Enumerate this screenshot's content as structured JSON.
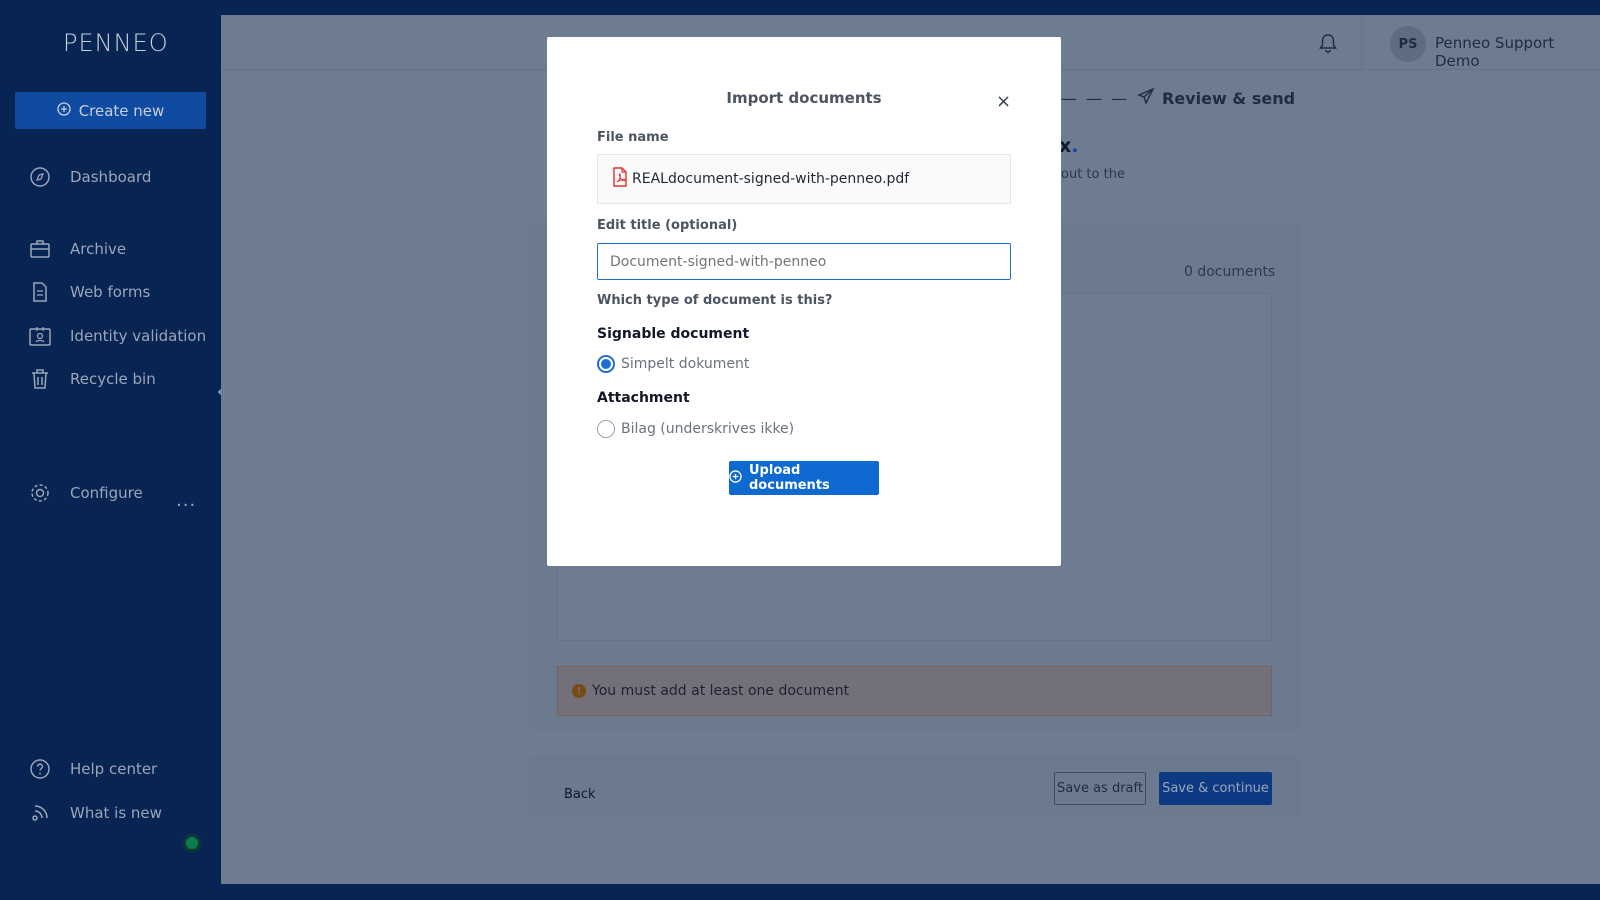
{
  "app": {
    "logo_text": "PENNEO"
  },
  "sidebar": {
    "create_label": "Create new",
    "items": [
      {
        "label": "Dashboard",
        "icon": "compass-icon"
      },
      {
        "label": "Archive",
        "icon": "briefcase-icon"
      },
      {
        "label": "Web forms",
        "icon": "document-icon"
      },
      {
        "label": "Identity validation",
        "icon": "id-card-icon"
      },
      {
        "label": "Recycle bin",
        "icon": "trash-icon"
      },
      {
        "label": "Configure",
        "icon": "gear-icon"
      },
      {
        "label": "Help center",
        "icon": "help-icon"
      },
      {
        "label": "What is new",
        "icon": "broadcast-icon"
      }
    ],
    "more_label": "···"
  },
  "header": {
    "avatar_initials": "PS",
    "user_name": "Penneo Support Demo"
  },
  "stepper": {
    "dashes": "— — —",
    "review_label": "Review & send"
  },
  "background": {
    "title_fragment": "x",
    "title_dot": ".",
    "subtitle_fragment": "out to the",
    "document_count": "0 documents",
    "alert_text": "You must add at least one document",
    "back_label": "Back",
    "save_draft_label": "Save as draft",
    "save_continue_label": "Save & continue"
  },
  "modal": {
    "title": "Import documents",
    "close_glyph": "×",
    "file_name_label": "File name",
    "file_name": "REALdocument-signed-with-penneo.pdf",
    "edit_title_label": "Edit title (optional)",
    "edit_title_placeholder": "Document-signed-with-penneo",
    "type_question": "Which type of document is this?",
    "signable_heading": "Signable document",
    "signable_option": "Simpelt dokument",
    "attachment_heading": "Attachment",
    "attachment_option": "Bilag (underskrives ikke)",
    "upload_label": "Upload documents"
  },
  "colors": {
    "sidebar_bg": "#072453",
    "primary": "#0e6ad0",
    "overlay_main": "#6e7c91",
    "pdf_red": "#e0332f"
  }
}
